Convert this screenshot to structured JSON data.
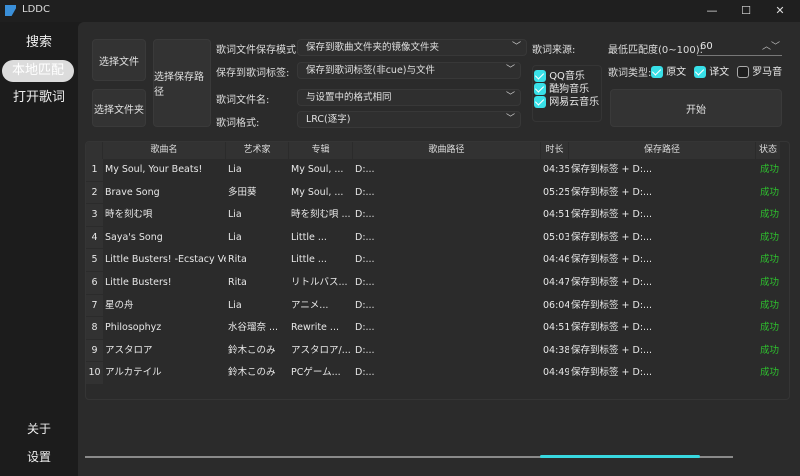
{
  "window": {
    "title": "LDDC",
    "controls": [
      "—",
      "☐",
      "✕"
    ]
  },
  "sidebar": {
    "items": [
      {
        "label": "搜索"
      },
      {
        "label": "本地匹配",
        "active": true
      },
      {
        "label": "打开歌词"
      }
    ],
    "bottom": [
      {
        "label": "关于"
      },
      {
        "label": "设置"
      }
    ]
  },
  "controls": {
    "select_file": "选择文件",
    "select_folder": "选择文件夹",
    "select_save_path": "选择保存路径",
    "save_mode_label": "歌词文件保存模式:",
    "save_mode_value": "保存到歌曲文件夹的镜像文件夹",
    "save_tag_label": "保存到歌词标签:",
    "save_tag_value": "保存到歌词标签(非cue)与文件",
    "filename_label": "歌词文件名:",
    "filename_value": "与设置中的格式相同",
    "format_label": "歌词格式:",
    "format_value": "LRC(逐字)",
    "source_label": "歌词来源:",
    "sources": [
      {
        "label": "QQ音乐",
        "checked": true
      },
      {
        "label": "酷狗音乐",
        "checked": true
      },
      {
        "label": "网易云音乐",
        "checked": true
      }
    ],
    "min_score_label": "最低匹配度(0~100):",
    "min_score_value": "60",
    "lyric_type_label": "歌词类型:",
    "lyric_types": [
      {
        "label": "原文",
        "checked": true
      },
      {
        "label": "译文",
        "checked": true
      },
      {
        "label": "罗马音",
        "checked": false
      }
    ],
    "start": "开始"
  },
  "table": {
    "headers": [
      "歌曲名",
      "艺术家",
      "专辑",
      "歌曲路径",
      "时长",
      "保存路径",
      "状态"
    ],
    "rows": [
      [
        "1",
        "My Soul, Your Beats!",
        "Lia",
        "My Soul, ...",
        "D:...",
        "04:35",
        "保存到标签 + D:...",
        "成功"
      ],
      [
        "2",
        "Brave Song",
        "多田葵",
        "My Soul, ...",
        "D:...",
        "05:25",
        "保存到标签 + D:...",
        "成功"
      ],
      [
        "3",
        "時を刻む唄",
        "Lia",
        "時を刻む唄 ...",
        "D:...",
        "04:51",
        "保存到标签 + D:...",
        "成功"
      ],
      [
        "4",
        "Saya's Song",
        "Lia",
        "Little ...",
        "D:...",
        "05:03",
        "保存到标签 + D:...",
        "成功"
      ],
      [
        "5",
        "Little Busters! -Ecstacy Ver.-",
        "Rita",
        "Little ...",
        "D:...",
        "04:46",
        "保存到标签 + D:...",
        "成功"
      ],
      [
        "6",
        "Little Busters!",
        "Rita",
        "リトルバス...",
        "D:...",
        "04:47",
        "保存到标签 + D:...",
        "成功"
      ],
      [
        "7",
        "星の舟",
        "Lia",
        "アニメ...",
        "D:...",
        "06:04",
        "保存到标签 + D:...",
        "成功"
      ],
      [
        "8",
        "Philosophyz",
        "水谷瑠奈 ...",
        "Rewrite ...",
        "D:...",
        "04:51",
        "保存到标签 + D:...",
        "成功"
      ],
      [
        "9",
        "アスタロア",
        "鈴木このみ",
        "アスタロア/...",
        "D:...",
        "04:38",
        "保存到标签 + D:...",
        "成功"
      ],
      [
        "10",
        "アルカテイル",
        "鈴木このみ",
        "PCゲーム...",
        "D:...",
        "04:49",
        "保存到标签 + D:...",
        "成功"
      ]
    ]
  },
  "progress": {
    "state": "indeterminate"
  },
  "colors": {
    "accent": "#38e0e8",
    "success": "#2ec02e"
  }
}
